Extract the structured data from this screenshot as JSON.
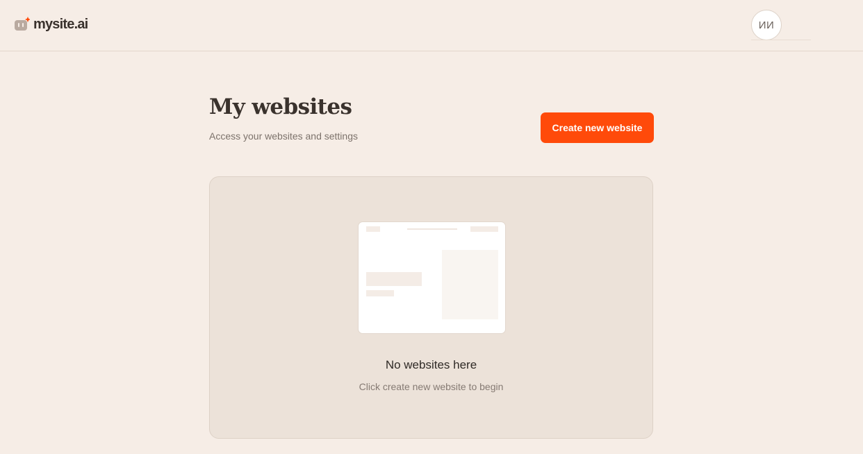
{
  "brand": {
    "name": "mysite.ai",
    "logo_icon": "mysite-logo-icon",
    "accent_color": "#ff4a0a"
  },
  "user": {
    "initials": "ИИ"
  },
  "page": {
    "title": "My websites",
    "subtitle": "Access your websites and settings"
  },
  "actions": {
    "create_label": "Create new website"
  },
  "empty_state": {
    "illustration": "website-preview-illustration",
    "title": "No websites here",
    "subtitle": "Click create new website to begin"
  }
}
